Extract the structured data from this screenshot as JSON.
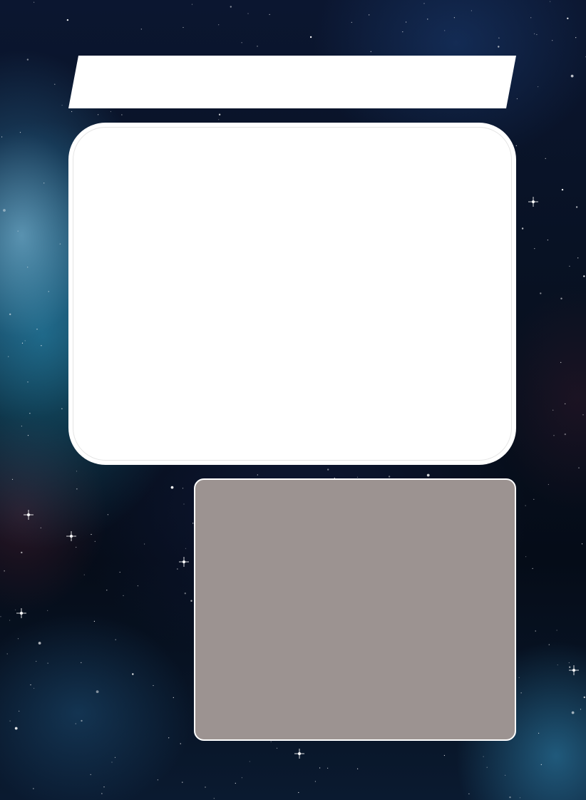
{
  "card": {
    "background": "space-nebula-starfield",
    "colors": {
      "title_banner": "#ffffff",
      "art_frame": "#ffffff",
      "text_box": "#9c9391",
      "text_box_border": "#ffffff"
    }
  }
}
